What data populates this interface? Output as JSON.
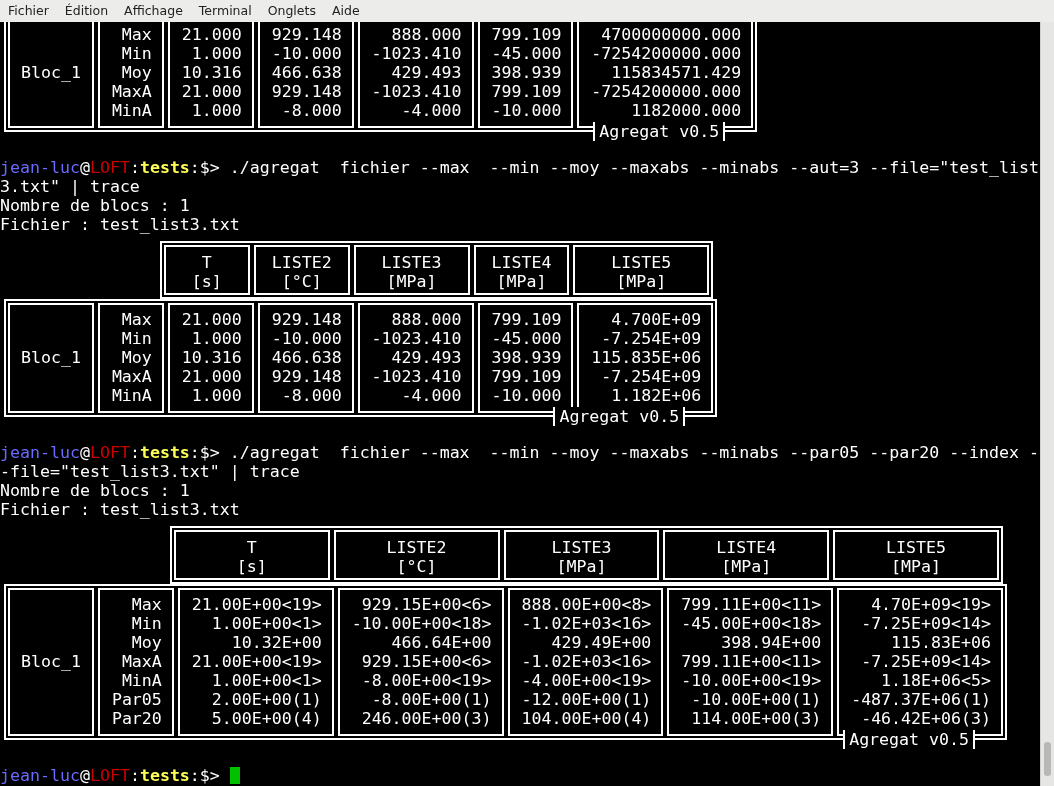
{
  "menu": [
    {
      "label": "Fichier"
    },
    {
      "label": "Édition"
    },
    {
      "label": "Affichage"
    },
    {
      "label": "Terminal"
    },
    {
      "label": "Onglets"
    },
    {
      "label": "Aide"
    }
  ],
  "terminal": [
    {
      "kind": "table",
      "block": "Bloc_1",
      "stats": [
        "Max",
        "Min",
        "Moy",
        "MaxA",
        "MinA"
      ],
      "columns": [
        {
          "values": [
            "21.000",
            "1.000",
            "10.316",
            "21.000",
            "1.000"
          ]
        },
        {
          "values": [
            "929.148",
            "-10.000",
            "466.638",
            "929.148",
            "-8.000"
          ]
        },
        {
          "values": [
            "888.000",
            "-1023.410",
            "429.493",
            "-1023.410",
            "-4.000"
          ]
        },
        {
          "values": [
            "799.109",
            "-45.000",
            "398.939",
            "799.109",
            "-10.000"
          ]
        },
        {
          "values": [
            "4700000000.000",
            "-7254200000.000",
            "115834571.429",
            "-7254200000.000",
            "1182000.000"
          ]
        }
      ],
      "footer": "Agregat v0.5"
    },
    {
      "kind": "prompt",
      "parts": [
        {
          "text": "jean-luc",
          "color": "#6a6aff"
        },
        {
          "text": "@",
          "color": "#ffffff"
        },
        {
          "text": "LOFT",
          "color": "#cd0000"
        },
        {
          "text": ":",
          "color": "#ffffff"
        },
        {
          "text": "tests",
          "color": "#ffff55"
        },
        {
          "text": ":$>",
          "color": "#ffffff"
        }
      ],
      "command": "./agregat  fichier --max  --min --moy --maxabs --minabs --aut=3 --file=\"test_list3.txt\" | trace"
    },
    {
      "kind": "output",
      "text": "Nombre de blocs : 1"
    },
    {
      "kind": "output",
      "text": "Fichier : test_list3.txt"
    },
    {
      "kind": "table",
      "block": "Bloc_1",
      "stats": [
        "Max",
        "Min",
        "Moy",
        "MaxA",
        "MinA"
      ],
      "columns": [
        {
          "name": "T",
          "unit": "[s]",
          "values": [
            "21.000",
            "1.000",
            "10.316",
            "21.000",
            "1.000"
          ]
        },
        {
          "name": "LISTE2",
          "unit": "[°C]",
          "values": [
            "929.148",
            "-10.000",
            "466.638",
            "929.148",
            "-8.000"
          ]
        },
        {
          "name": "LISTE3",
          "unit": "[MPa]",
          "values": [
            "888.000",
            "-1023.410",
            "429.493",
            "-1023.410",
            "-4.000"
          ]
        },
        {
          "name": "LISTE4",
          "unit": "[MPa]",
          "values": [
            "799.109",
            "-45.000",
            "398.939",
            "799.109",
            "-10.000"
          ]
        },
        {
          "name": "LISTE5",
          "unit": "[MPa]",
          "values": [
            "4.700E+09",
            "-7.254E+09",
            "115.835E+06",
            "-7.254E+09",
            "1.182E+06"
          ]
        }
      ],
      "footer": "Agregat v0.5"
    },
    {
      "kind": "prompt",
      "parts": [
        {
          "text": "jean-luc",
          "color": "#6a6aff"
        },
        {
          "text": "@",
          "color": "#ffffff"
        },
        {
          "text": "LOFT",
          "color": "#cd0000"
        },
        {
          "text": ":",
          "color": "#ffffff"
        },
        {
          "text": "tests",
          "color": "#ffff55"
        },
        {
          "text": ":$>",
          "color": "#ffffff"
        }
      ],
      "command": "./agregat  fichier --max  --min --moy --maxabs --minabs --par05 --par20 --index --file=\"test_list3.txt\" | trace"
    },
    {
      "kind": "output",
      "text": "Nombre de blocs : 1"
    },
    {
      "kind": "output",
      "text": "Fichier : test_list3.txt"
    },
    {
      "kind": "table",
      "block": "Bloc_1",
      "stats": [
        "Max",
        "Min",
        "Moy",
        "MaxA",
        "MinA",
        "Par05",
        "Par20"
      ],
      "columns": [
        {
          "name": "T",
          "unit": "[s]",
          "values": [
            "21.00E+00<19>",
            "1.00E+00<1>",
            "10.32E+00",
            "21.00E+00<19>",
            "1.00E+00<1>",
            "2.00E+00(1)",
            "5.00E+00(4)"
          ]
        },
        {
          "name": "LISTE2",
          "unit": "[°C]",
          "values": [
            "929.15E+00<6>",
            "-10.00E+00<18>",
            "466.64E+00",
            "929.15E+00<6>",
            "-8.00E+00<19>",
            "-8.00E+00(1)",
            "246.00E+00(3)"
          ]
        },
        {
          "name": "LISTE3",
          "unit": "[MPa]",
          "values": [
            "888.00E+00<8>",
            "-1.02E+03<16>",
            "429.49E+00",
            "-1.02E+03<16>",
            "-4.00E+00<19>",
            "-12.00E+00(1)",
            "104.00E+00(4)"
          ]
        },
        {
          "name": "LISTE4",
          "unit": "[MPa]",
          "values": [
            "799.11E+00<11>",
            "-45.00E+00<18>",
            "398.94E+00",
            "799.11E+00<11>",
            "-10.00E+00<19>",
            "-10.00E+00(1)",
            "114.00E+00(3)"
          ]
        },
        {
          "name": "LISTE5",
          "unit": "[MPa]",
          "values": [
            "4.70E+09<19>",
            "-7.25E+09<14>",
            "115.83E+06",
            "-7.25E+09<14>",
            "1.18E+06<5>",
            "-487.37E+06(1)",
            "-46.42E+06(3)"
          ]
        }
      ],
      "footer": "Agregat v0.5"
    },
    {
      "kind": "prompt",
      "parts": [
        {
          "text": "jean-luc",
          "color": "#6a6aff"
        },
        {
          "text": "@",
          "color": "#ffffff"
        },
        {
          "text": "LOFT",
          "color": "#cd0000"
        },
        {
          "text": ":",
          "color": "#ffffff"
        },
        {
          "text": "tests",
          "color": "#ffff55"
        },
        {
          "text": ":$>",
          "color": "#ffffff"
        }
      ],
      "cursor": true
    }
  ]
}
